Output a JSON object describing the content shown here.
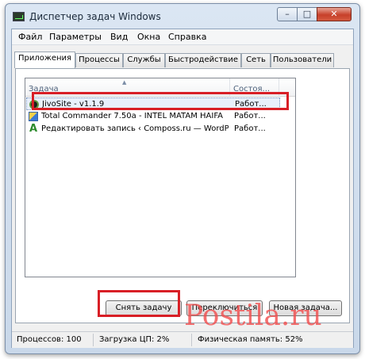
{
  "window": {
    "title": "Диспетчер задач Windows",
    "min_glyph": "–",
    "max_glyph": "□",
    "close_glyph": "✕"
  },
  "menu": [
    "Файл",
    "Параметры",
    "Вид",
    "Окна",
    "Справка"
  ],
  "tabs": [
    "Приложения",
    "Процессы",
    "Службы",
    "Быстродействие",
    "Сеть",
    "Пользователи"
  ],
  "active_tab": "Приложения",
  "list": {
    "columns": [
      "Задача",
      "Состоя..."
    ],
    "sort_indicator": "▲",
    "rows": [
      {
        "icon": "jivosite-icon",
        "name": "JivoSite - v1.1.9",
        "state": "Работ...",
        "selected": true
      },
      {
        "icon": "total-commander-icon",
        "name": "Total Commander 7.50a - INTEL MATAM HAIFA",
        "state": "Работ..."
      },
      {
        "icon": "compose-a-icon",
        "icon_glyph": "A",
        "name": "Редактировать запись ‹ Composs.ru — WordP...",
        "state": "Работ..."
      }
    ]
  },
  "buttons": {
    "end_task": "Снять задачу",
    "switch_to": "Переключиться",
    "new_task": "Новая задача..."
  },
  "status": {
    "processes": "Процессов: 100",
    "cpu": "Загрузка ЦП: 2%",
    "memory": "Физическая память: 52%"
  },
  "watermark": "Postila.ru",
  "colors": {
    "highlight": "#d81f26",
    "watermark": "#f15050",
    "selection": "#e8f0fc"
  }
}
